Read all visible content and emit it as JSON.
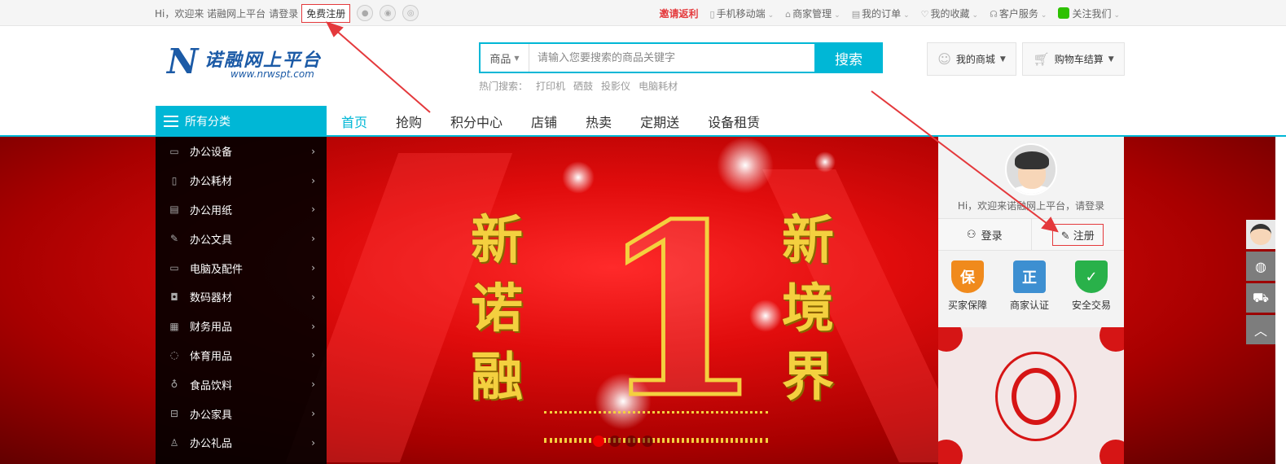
{
  "topbar": {
    "greeting": "Hi，欢迎来 诺融网上平台",
    "login": "请登录",
    "register": "免费注册",
    "invite": "邀请返利",
    "items": [
      {
        "label": "手机移动端",
        "icon": "phone-icon"
      },
      {
        "label": "商家管理",
        "icon": "home-icon"
      },
      {
        "label": "我的订单",
        "icon": "order-icon"
      },
      {
        "label": "我的收藏",
        "icon": "heart-icon"
      },
      {
        "label": "客户服务",
        "icon": "headset-icon"
      }
    ],
    "follow": "关注我们"
  },
  "logo": {
    "letter": "N",
    "name": "诺融网上平台",
    "url": "www.nrwspt.com"
  },
  "search": {
    "category": "商品",
    "placeholder": "请输入您要搜索的商品关键字",
    "button": "搜索",
    "hot_label": "热门搜索：",
    "hot_keywords": [
      "打印机",
      "硒鼓",
      "投影仪",
      "电脑耗材"
    ]
  },
  "header_buttons": {
    "my_store": "我的商城",
    "cart": "购物车结算"
  },
  "nav": {
    "all_categories": "所有分类",
    "links": [
      "首页",
      "抢购",
      "积分中心",
      "店铺",
      "热卖",
      "定期送",
      "设备租赁"
    ]
  },
  "categories": [
    "办公设备",
    "办公耗材",
    "办公用纸",
    "办公文具",
    "电脑及配件",
    "数码器材",
    "财务用品",
    "体育用品",
    "食品饮料",
    "办公家具",
    "办公礼品"
  ],
  "banner": {
    "left_text": [
      "新",
      "诺",
      "融"
    ],
    "right_text": [
      "新",
      "境",
      "界"
    ],
    "number": "1",
    "slides": 4,
    "active_slide": 0
  },
  "panel": {
    "greeting": "Hi，欢迎来诺融网上平台，请登录",
    "login": "登录",
    "register": "注册",
    "features": [
      {
        "label": "买家保障",
        "badge": "保",
        "color": "#f08a1c"
      },
      {
        "label": "商家认证",
        "badge": "正",
        "color": "#3d8fd1"
      },
      {
        "label": "安全交易",
        "badge": "✓",
        "color": "#29b14a"
      }
    ]
  },
  "colors": {
    "accent": "#00b7d6",
    "highlight": "#e4393c",
    "banner": "#e00c0c"
  }
}
